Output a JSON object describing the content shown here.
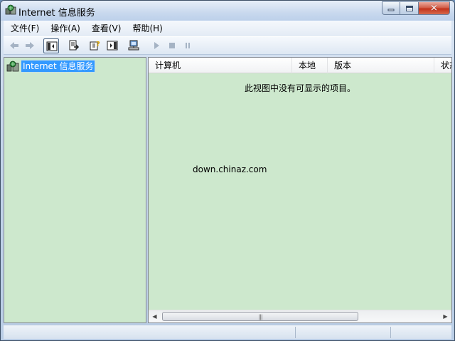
{
  "window": {
    "title": "Internet 信息服务",
    "controls": {
      "minimize": "minimize-icon",
      "maximize": "maximize-icon",
      "close": "close-icon"
    }
  },
  "menu": {
    "items": [
      {
        "label": "文件(F)"
      },
      {
        "label": "操作(A)"
      },
      {
        "label": "查看(V)"
      },
      {
        "label": "帮助(H)"
      }
    ]
  },
  "toolbar": {
    "buttons": [
      {
        "icon": "back-arrow-icon",
        "enabled": false
      },
      {
        "icon": "forward-arrow-icon",
        "enabled": false
      },
      {
        "icon": "show-hide-tree-icon",
        "enabled": true,
        "active": true
      },
      {
        "icon": "export-list-icon",
        "enabled": true
      },
      {
        "icon": "help-icon",
        "enabled": true
      },
      {
        "icon": "properties-pane-icon",
        "enabled": true
      },
      {
        "icon": "connect-computer-icon",
        "enabled": true
      },
      {
        "icon": "play-icon",
        "enabled": false
      },
      {
        "icon": "stop-icon",
        "enabled": false
      },
      {
        "icon": "pause-icon",
        "enabled": false
      }
    ]
  },
  "tree": {
    "root": {
      "label": "Internet 信息服务",
      "icon": "iis-server-icon",
      "selected": true
    }
  },
  "list": {
    "columns": [
      {
        "label": "计算机"
      },
      {
        "label": "本地"
      },
      {
        "label": "版本"
      },
      {
        "label": "状态"
      }
    ],
    "empty_message": "此视图中没有可显示的项目。",
    "watermark": "down.chinaz.com"
  },
  "colors": {
    "pane_background": "#cde8cd",
    "selection": "#3399ff",
    "chrome": "#c4d5ea"
  }
}
